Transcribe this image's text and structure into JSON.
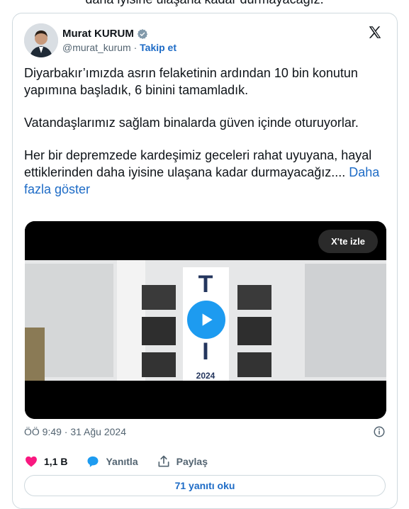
{
  "top_text": "daha iyisine ulaşana kadar durmayacağız.",
  "author": {
    "name": "Murat KURUM",
    "handle": "@murat_kurum",
    "separator": "·",
    "follow_label": "Takip et"
  },
  "tweet": {
    "para1": "Diyarbakır’ımızda asrın felaketinin ardından 10 bin konutun yapımına başladık, 6 binini tamamladık.",
    "para2": "Vatandaşlarımız sağlam binalarda güven içinde oturuyorlar.",
    "para3": "Her bir depremzede kardeşimiz geceleri rahat uyuyana, hayal ettiklerinden daha iyisine ulaşana kadar durmayacağız....",
    "show_more": "Daha fazla göster"
  },
  "video": {
    "watch_label": "X'te izle",
    "sign_text": "2024"
  },
  "timestamp": "ÖÖ 9:49 · 31 Ağu 2024",
  "actions": {
    "likes": "1,1 B",
    "reply": "Yanıtla",
    "share": "Paylaş"
  },
  "read_replies": "71 yanıtı oku",
  "colors": {
    "link": "#1d6bc6",
    "like": "#f91880",
    "reply_icon": "#1d9bf0",
    "play": "#1d9bf0"
  },
  "icons": [
    "verified-badge-icon",
    "x-logo-icon",
    "play-icon",
    "info-icon",
    "heart-icon",
    "reply-bubble-icon",
    "share-icon"
  ]
}
